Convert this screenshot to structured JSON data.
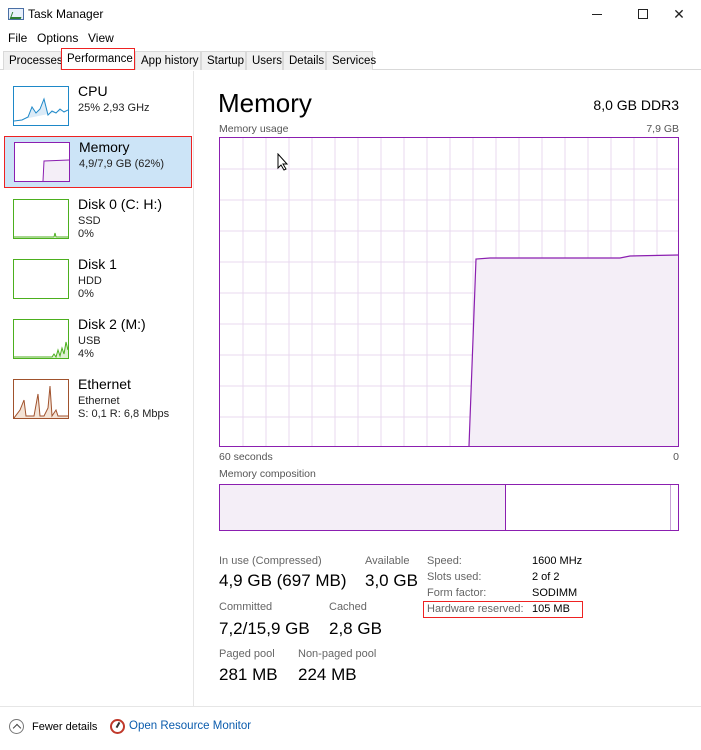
{
  "window": {
    "title": "Task Manager"
  },
  "menu": [
    "File",
    "Options",
    "View"
  ],
  "tabs": [
    {
      "label": "Processes",
      "active": false
    },
    {
      "label": "Performance",
      "active": true
    },
    {
      "label": "App history",
      "active": false
    },
    {
      "label": "Startup",
      "active": false
    },
    {
      "label": "Users",
      "active": false
    },
    {
      "label": "Details",
      "active": false
    },
    {
      "label": "Services",
      "active": false
    }
  ],
  "sidebar": {
    "items": [
      {
        "title": "CPU",
        "sub1": "25% 2,93 GHz",
        "sub2": "",
        "selected": false,
        "color": "#1e88c8"
      },
      {
        "title": "Memory",
        "sub1": "4,9/7,9 GB (62%)",
        "sub2": "",
        "selected": true,
        "color": "#8b1fb0"
      },
      {
        "title": "Disk 0 (C: H:)",
        "sub1": "SSD",
        "sub2": "0%",
        "selected": false,
        "color": "#4caf1e"
      },
      {
        "title": "Disk 1",
        "sub1": "HDD",
        "sub2": "0%",
        "selected": false,
        "color": "#4caf1e"
      },
      {
        "title": "Disk 2 (M:)",
        "sub1": "USB",
        "sub2": "4%",
        "selected": false,
        "color": "#4caf1e"
      },
      {
        "title": "Ethernet",
        "sub1": "Ethernet",
        "sub2": "S: 0,1 R: 6,8 Mbps",
        "selected": false,
        "color": "#a0522d"
      }
    ]
  },
  "main": {
    "title": "Memory",
    "spec": "8,0 GB DDR3",
    "usage_label": "Memory usage",
    "usage_max": "7,9 GB",
    "time_left": "60 seconds",
    "time_right": "0",
    "composition_label": "Memory composition"
  },
  "stats": {
    "in_use_label": "In use (Compressed)",
    "in_use_value": "4,9 GB (697 MB)",
    "available_label": "Available",
    "available_value": "3,0 GB",
    "committed_label": "Committed",
    "committed_value": "7,2/15,9 GB",
    "cached_label": "Cached",
    "cached_value": "2,8 GB",
    "paged_label": "Paged pool",
    "paged_value": "281 MB",
    "nonpaged_label": "Non-paged pool",
    "nonpaged_value": "224 MB"
  },
  "specs": [
    {
      "label": "Speed:",
      "value": "1600 MHz"
    },
    {
      "label": "Slots used:",
      "value": "2 of 2"
    },
    {
      "label": "Form factor:",
      "value": "SODIMM"
    },
    {
      "label": "Hardware reserved:",
      "value": "105 MB"
    }
  ],
  "footer": {
    "fewer_details": "Fewer details",
    "resource_monitor": "Open Resource Monitor"
  },
  "colors": {
    "memory_accent": "#8b1fb0",
    "memory_fill": "#f4eef7",
    "highlight_border": "#e22222",
    "selected_bg": "#cce4f7",
    "link": "#0b5cad"
  }
}
